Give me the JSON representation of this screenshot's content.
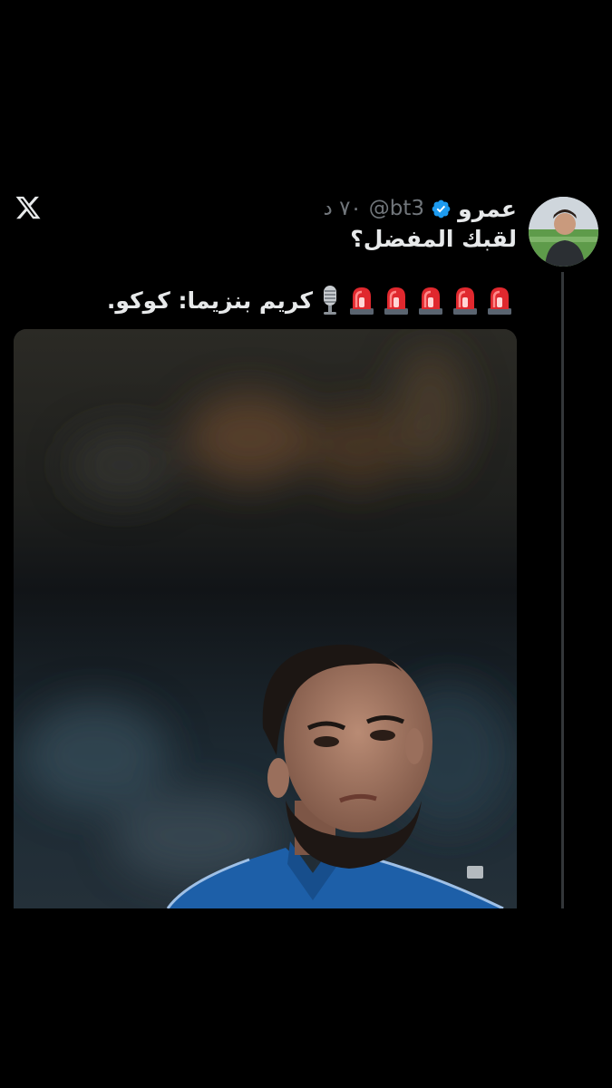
{
  "tweet": {
    "display_name": "عمرو",
    "handle": "@bt3",
    "time": "٧٠ د",
    "text": "لقبك المفضل؟"
  },
  "quote": {
    "headline": "كريم بنزيما: كوكو.",
    "siren_count": 5
  },
  "icons": {
    "app_logo": "x-logo-icon",
    "verified": "verified-badge-icon",
    "siren": "police-siren-icon",
    "mic": "studio-microphone-icon"
  },
  "colors": {
    "background": "#000000",
    "text": "#e7e9ea",
    "muted": "#71767b",
    "verified": "#1d9bf0",
    "thread_line": "#333639",
    "jersey": "#1d5fa8"
  }
}
